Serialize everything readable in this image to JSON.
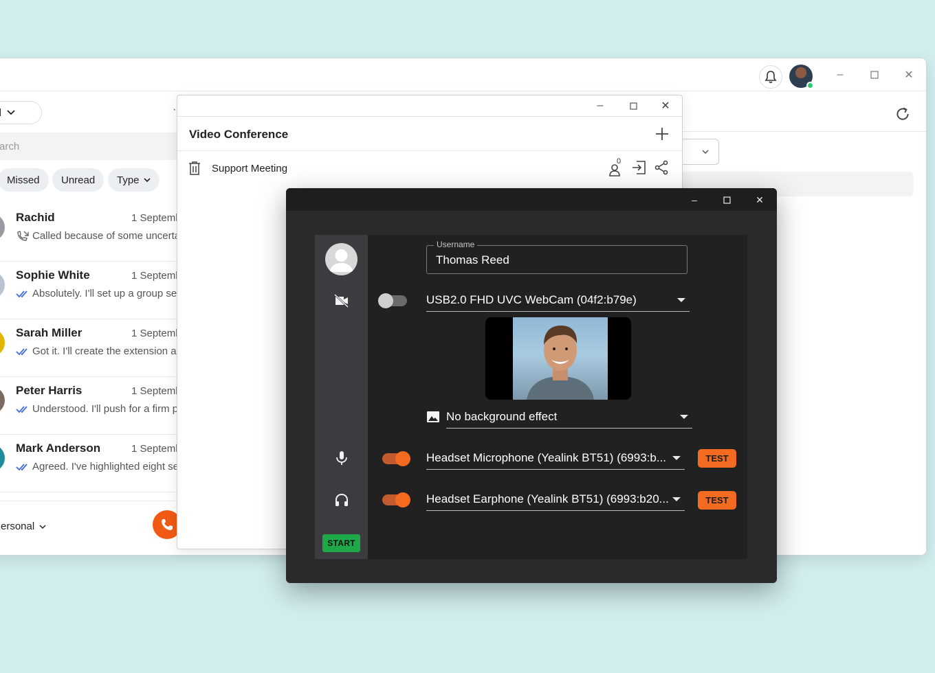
{
  "main_window": {
    "scope_dropdown": "nal",
    "more_menu": "·",
    "search_placeholder": "arch",
    "filters": [
      "Missed",
      "Unread",
      "Type"
    ],
    "chats": [
      {
        "name": "Rachid",
        "date": "1 Septemb",
        "message": "Called because of some uncerta",
        "status_icon": "missed-call-icon",
        "avatar_color": "#9a9aa0"
      },
      {
        "name": "Sophie White",
        "date": "1 Septemb",
        "message": "Absolutely. I'll set up a group ses",
        "status_icon": "read-check-icon",
        "avatar_color": "#b7c3cf"
      },
      {
        "name": "Sarah Miller",
        "date": "1 Septemb",
        "message": "Got it. I'll create the extension ar",
        "status_icon": "read-check-icon",
        "avatar_color": "#e3b400"
      },
      {
        "name": "Peter Harris",
        "date": "1 Septemb",
        "message": "Understood. I'll push for a firm p",
        "status_icon": "read-check-icon",
        "avatar_color": "#7a6a60"
      },
      {
        "name": "Mark Anderson",
        "date": "1 Septemb",
        "message": "Agreed. I've highlighted eight se",
        "status_icon": "read-check-icon",
        "avatar_color": "#1e8c9a"
      }
    ],
    "footer_account": "ersonal"
  },
  "video_conference": {
    "title": "Video Conference",
    "meeting": {
      "name": "Support Meeting",
      "participant_count": "0"
    }
  },
  "device_settings": {
    "username_label": "Username",
    "username_value": "Thomas Reed",
    "camera": {
      "label": "USB2.0 FHD UVC WebCam (04f2:b79e)",
      "enabled": false
    },
    "background": {
      "label": "No background effect"
    },
    "microphone": {
      "label": "Headset Microphone (Yealink BT51) (6993:b...",
      "enabled": true,
      "test_label": "TEST"
    },
    "speaker": {
      "label": "Headset Earphone (Yealink BT51) (6993:b20...",
      "enabled": true,
      "test_label": "TEST"
    },
    "start_label": "START"
  },
  "colors": {
    "accent": "#f26b21",
    "start_green": "#1fa848",
    "check_blue": "#3d6de0"
  }
}
